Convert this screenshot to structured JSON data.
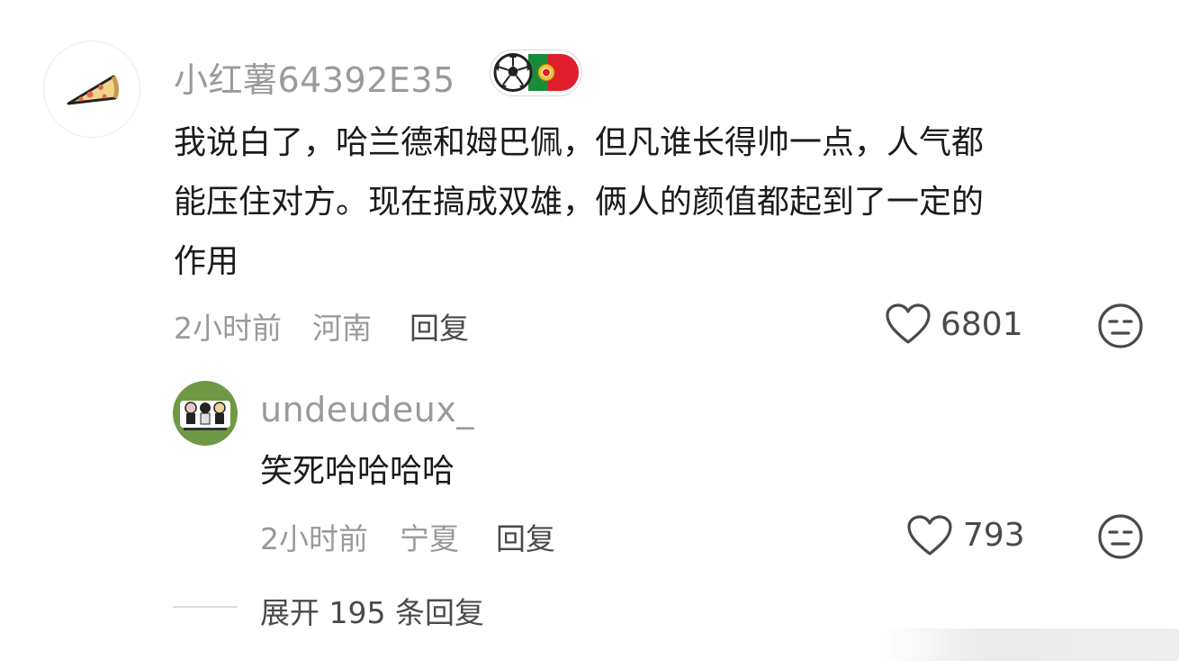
{
  "comment": {
    "username": "小红薯64392E35",
    "badge_icons": [
      "soccer-ball-icon",
      "portugal-flag-icon"
    ],
    "avatar_icon": "pizza-slice-icon",
    "text_lines": [
      "我说白了，哈兰德和姆巴佩，但凡谁长得帅一点，人气都",
      "能压住对方。现在搞成双雄，俩人的颜值都起到了一定的",
      "作用"
    ],
    "time": "2小时前",
    "location": "河南",
    "reply_label": "回复",
    "like_count": "6801"
  },
  "reply": {
    "username": "undeudeux_",
    "text": "笑死哈哈哈哈",
    "time": "2小时前",
    "location": "宁夏",
    "reply_label": "回复",
    "like_count": "793"
  },
  "expand_label": "展开 195 条回复",
  "colors": {
    "username": "#9a9a9a",
    "text": "#1b1b1b",
    "meta": "#9a9a9a",
    "action": "#4a4a4a",
    "reply_avatar_bg": "#6f9845"
  }
}
